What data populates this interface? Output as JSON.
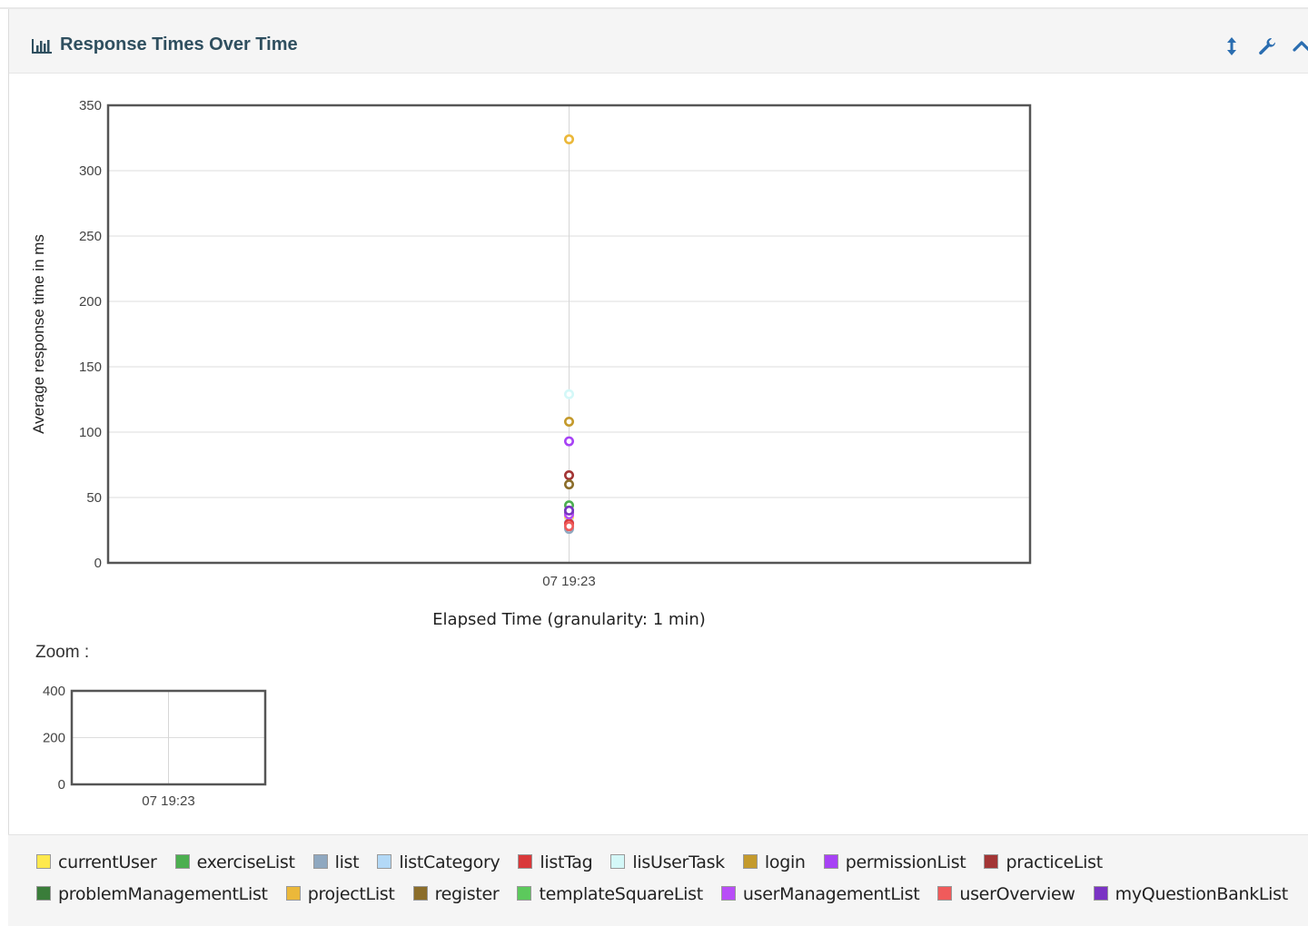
{
  "panel": {
    "title": "Response Times Over Time",
    "icons": {
      "title": "bar-chart-icon",
      "expand": "vertical-resize-icon",
      "settings": "wrench-icon",
      "collapse": "chevron-up-icon"
    }
  },
  "zoom": {
    "label": "Zoom :"
  },
  "chart_data": [
    {
      "type": "scatter",
      "xlabel": "Elapsed Time (granularity: 1 min)",
      "ylabel": "Average response time in ms",
      "ylim": [
        0,
        350
      ],
      "yticks": [
        0,
        50,
        100,
        150,
        200,
        250,
        300,
        350
      ],
      "x_categories": [
        "07 19:23"
      ],
      "grid": true,
      "legend": "bottom",
      "series": [
        {
          "name": "currentUser",
          "color": "#ffe94d",
          "values": [
            35
          ]
        },
        {
          "name": "exerciseList",
          "color": "#4caf50",
          "values": [
            44
          ]
        },
        {
          "name": "list",
          "color": "#8fa8c0",
          "values": [
            26
          ]
        },
        {
          "name": "listCategory",
          "color": "#b3d9f7",
          "values": [
            31
          ]
        },
        {
          "name": "listTag",
          "color": "#d9383a",
          "values": [
            30
          ]
        },
        {
          "name": "lisUserTask",
          "color": "#d4f8f8",
          "values": [
            129
          ]
        },
        {
          "name": "login",
          "color": "#c49a2c",
          "values": [
            108
          ]
        },
        {
          "name": "permissionList",
          "color": "#a742f5",
          "values": [
            93
          ]
        },
        {
          "name": "practiceList",
          "color": "#a33535",
          "values": [
            67
          ]
        },
        {
          "name": "problemManagementList",
          "color": "#3a7d3a",
          "values": [
            38
          ]
        },
        {
          "name": "projectList",
          "color": "#ebb83a",
          "values": [
            324
          ]
        },
        {
          "name": "register",
          "color": "#8b6d2a",
          "values": [
            60
          ]
        },
        {
          "name": "templateSquareList",
          "color": "#5cc95c",
          "values": [
            40
          ]
        },
        {
          "name": "userManagementList",
          "color": "#b84df7",
          "values": [
            37
          ]
        },
        {
          "name": "userOverview",
          "color": "#f05b5b",
          "values": [
            28
          ]
        },
        {
          "name": "myQuestionBankList",
          "color": "#7a33c4",
          "values": [
            40
          ]
        }
      ]
    },
    {
      "type": "scatter",
      "ylim": [
        0,
        400
      ],
      "yticks": [
        0,
        200,
        400
      ],
      "x_categories": [
        "07 19:23"
      ],
      "grid": true
    }
  ],
  "legend_rows": [
    [
      "currentUser",
      "exerciseList",
      "list",
      "listCategory",
      "listTag",
      "lisUserTask",
      "login",
      "permissionList",
      "practiceList"
    ],
    [
      "problemManagementList",
      "projectList",
      "register",
      "templateSquareList",
      "userManagementList",
      "userOverview",
      "myQuestionBankList"
    ]
  ]
}
